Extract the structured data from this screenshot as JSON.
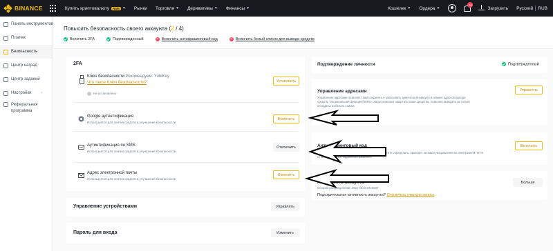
{
  "nav": {
    "brand": "BINANCE",
    "links": [
      {
        "label": "Купить криптовалюту",
        "badge": "RUB",
        "caret": true
      },
      {
        "label": "Рынки",
        "caret": false
      },
      {
        "label": "Торговля",
        "caret": true
      },
      {
        "label": "Деривативы",
        "caret": true
      },
      {
        "label": "Финансы",
        "caret": true
      }
    ],
    "right": {
      "wallet": "Кошелек",
      "orders": "Ордера",
      "notifications_count": "24",
      "download": "Загрузить",
      "language": "Русский",
      "currency": "RUB"
    }
  },
  "sidebar": {
    "items": [
      {
        "label": "Панель инструментов",
        "icon": "dashboard-icon",
        "active": false
      },
      {
        "label": "Платеж",
        "icon": "wallet-icon",
        "active": false
      },
      {
        "label": "Безопасность",
        "icon": "shield-icon",
        "active": true
      },
      {
        "label": "Центр наград",
        "icon": "reward-icon",
        "active": false
      },
      {
        "label": "Центр заданий",
        "icon": "task-icon",
        "active": false
      },
      {
        "label": "Настройки",
        "icon": "settings-icon",
        "active": false,
        "arrow": "›"
      },
      {
        "label": "Реферальная",
        "label2": "программа",
        "icon": "referral-icon",
        "active": false
      }
    ]
  },
  "header": {
    "title": "Повысить безопасность своего аккаунта (",
    "level": "2",
    "total": " / 4)",
    "checks": [
      {
        "label": "Включить 2FA",
        "ok": true
      },
      {
        "label": "Подтвержденный",
        "ok": true
      },
      {
        "label": "Включить антифишинговый код",
        "ok": false
      },
      {
        "label": "Включить белый список для вывода средств",
        "ok": false
      }
    ]
  },
  "twofa": {
    "title": "2FA",
    "security_key": {
      "title": "Ключ безопасности",
      "recommended": "Рекомендуем: YubiKey",
      "link": "Что такое Ключ безопасности?",
      "status": "Не установлено",
      "button": "Установить"
    },
    "google": {
      "title": "Google аутентификация",
      "sub": "Используется для снятия средств и улучшения безопасности",
      "button": "Включить"
    },
    "sms": {
      "title": "Аутентификация по SMS",
      "sub": "Используется для снятия средств и улучшения безопасности",
      "button": "Отключить"
    },
    "email": {
      "title": "Адрес электронной почты",
      "sub": "Используется для снятия средств и улучшения безопасности",
      "button": "Изменить"
    }
  },
  "devices": {
    "title": "Управление устройствами",
    "button": "Управлять"
  },
  "password": {
    "title": "Пароль для входа",
    "button": "Изменить"
  },
  "identity": {
    "title": "Подтверждение личности",
    "status": "Подтвержденный"
  },
  "address": {
    "title": "Управление адресами",
    "desc1": "Управление адресами позволяет вам сохранять и записывать заметки для каждого из ваших адресов вывода",
    "desc2": "средств. Опциональная функция белого списка помогает защитить ваши средства, позволяя выводить их только",
    "desc3": "на адреса из белого списка.",
    "whitelist": "Белый список отключен",
    "button": "Управлять"
  },
  "antiphishing": {
    "title": "Антифишинговый код",
    "desc1": "Защитите свой аккаунт от фишинговых атак и помогите определить, приходят ли ваши уведомления по электронной почте",
    "desc2": "от Binance или из поддельных фишинга.",
    "button": "Включить"
  },
  "activity": {
    "title": "Активность аккаунта",
    "history": "История распределений: 2021-05-03 05:25:07",
    "question": "Подозрительная активность аккаунта?",
    "link": "Отключить учетную запись",
    "button": "Больше"
  }
}
